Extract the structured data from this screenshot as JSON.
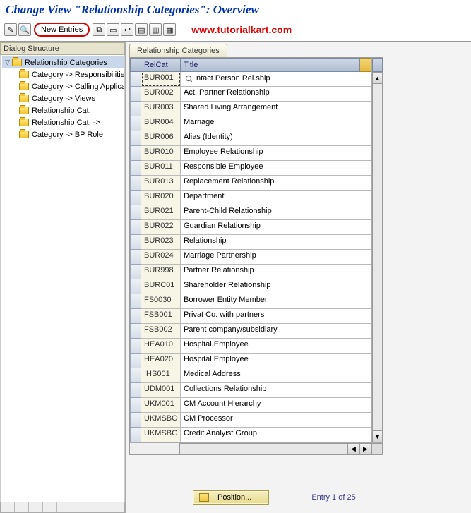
{
  "page_title": "Change View \"Relationship Categories\": Overview",
  "watermark": "www.tutorialkart.com",
  "toolbar": {
    "new_entries_label": "New Entries"
  },
  "tree": {
    "header": "Dialog Structure",
    "root": {
      "label": "Relationship Categories"
    },
    "children": [
      {
        "label": "Category -> Responsibilities"
      },
      {
        "label": "Category -> Calling Applications"
      },
      {
        "label": "Category -> Views"
      },
      {
        "label": "Relationship Cat."
      },
      {
        "label": "Relationship Cat. ->"
      },
      {
        "label": "Category -> BP Role"
      }
    ]
  },
  "right": {
    "tab_label": "Relationship Categories",
    "columns": {
      "relcat": "RelCat",
      "title": "Title"
    },
    "rows": [
      {
        "relcat": "BUR001",
        "title": "Contact Person Rel.ship"
      },
      {
        "relcat": "BUR002",
        "title": "Act. Partner Relationship"
      },
      {
        "relcat": "BUR003",
        "title": "Shared Living Arrangement"
      },
      {
        "relcat": "BUR004",
        "title": "Marriage"
      },
      {
        "relcat": "BUR006",
        "title": "Alias (Identity)"
      },
      {
        "relcat": "BUR010",
        "title": "Employee Relationship"
      },
      {
        "relcat": "BUR011",
        "title": "Responsible Employee"
      },
      {
        "relcat": "BUR013",
        "title": "Replacement Relationship"
      },
      {
        "relcat": "BUR020",
        "title": "Department"
      },
      {
        "relcat": "BUR021",
        "title": "Parent-Child Relationship"
      },
      {
        "relcat": "BUR022",
        "title": "Guardian Relationship"
      },
      {
        "relcat": "BUR023",
        "title": "Relationship"
      },
      {
        "relcat": "BUR024",
        "title": "Marriage Partnership"
      },
      {
        "relcat": "BUR998",
        "title": "Partner Relationship"
      },
      {
        "relcat": "BURC01",
        "title": "Shareholder Relationship"
      },
      {
        "relcat": "FS0030",
        "title": "Borrower Entity Member"
      },
      {
        "relcat": "FSB001",
        "title": "Privat Co. with partners"
      },
      {
        "relcat": "FSB002",
        "title": "Parent company/subsidiary"
      },
      {
        "relcat": "HEA010",
        "title": "Hospital Employee"
      },
      {
        "relcat": "HEA020",
        "title": "Hospital Employee"
      },
      {
        "relcat": "IHS001",
        "title": "Medical Address"
      },
      {
        "relcat": "UDM001",
        "title": "Collections Relationship"
      },
      {
        "relcat": "UKM001",
        "title": "CM Account Hierarchy"
      },
      {
        "relcat": "UKMSBO",
        "title": "CM Processor"
      },
      {
        "relcat": "UKMSBG",
        "title": "Credit Analyist Group"
      }
    ],
    "position_label": "Position...",
    "entry_label": "Entry 1 of 25"
  }
}
